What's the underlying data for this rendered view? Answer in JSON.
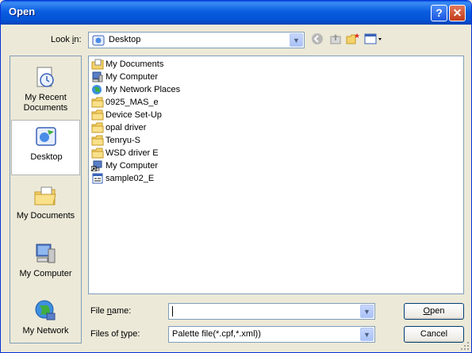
{
  "window": {
    "title": "Open",
    "help_glyph": "?",
    "close_glyph": "✕"
  },
  "look_in": {
    "label_pre": "Look ",
    "label_key": "i",
    "label_post": "n:",
    "value": "Desktop"
  },
  "places": [
    {
      "id": "recent",
      "label_line1": "My Recent",
      "label_line2": "Documents",
      "icon": "recent-documents-icon"
    },
    {
      "id": "desktop",
      "label_line1": "Desktop",
      "label_line2": "",
      "icon": "desktop-icon",
      "selected": true
    },
    {
      "id": "mydocs",
      "label_line1": "My Documents",
      "label_line2": "",
      "icon": "my-documents-icon"
    },
    {
      "id": "mycomputer",
      "label_line1": "My Computer",
      "label_line2": "",
      "icon": "my-computer-icon"
    },
    {
      "id": "network",
      "label_line1": "My Network",
      "label_line2": "",
      "icon": "my-network-icon"
    }
  ],
  "files": [
    {
      "name": "My Documents",
      "icon": "my-documents-icon"
    },
    {
      "name": "My Computer",
      "icon": "my-computer-icon"
    },
    {
      "name": "My Network Places",
      "icon": "network-places-icon"
    },
    {
      "name": "0925_MAS_e",
      "icon": "folder-icon"
    },
    {
      "name": "Device Set-Up",
      "icon": "folder-icon"
    },
    {
      "name": "opal driver",
      "icon": "folder-icon"
    },
    {
      "name": "Tenryu-S",
      "icon": "folder-icon"
    },
    {
      "name": "WSD driver E",
      "icon": "folder-icon"
    },
    {
      "name": "My Computer",
      "icon": "shortcut-computer-icon"
    },
    {
      "name": "sample02_E",
      "icon": "file-icon"
    }
  ],
  "file_name": {
    "label_pre": "File ",
    "label_key": "n",
    "label_post": "ame:",
    "value": ""
  },
  "file_type": {
    "label_pre": "Files of ",
    "label_key": "t",
    "label_post": "ype:",
    "value": "Palette file(*.cpf,*.xml))"
  },
  "buttons": {
    "open_key": "O",
    "open_rest": "pen",
    "cancel": "Cancel"
  },
  "colors": {
    "titlebar": "#0a5ddf",
    "folder": "#f5d36b",
    "selection_border": "#b4b4b4"
  }
}
